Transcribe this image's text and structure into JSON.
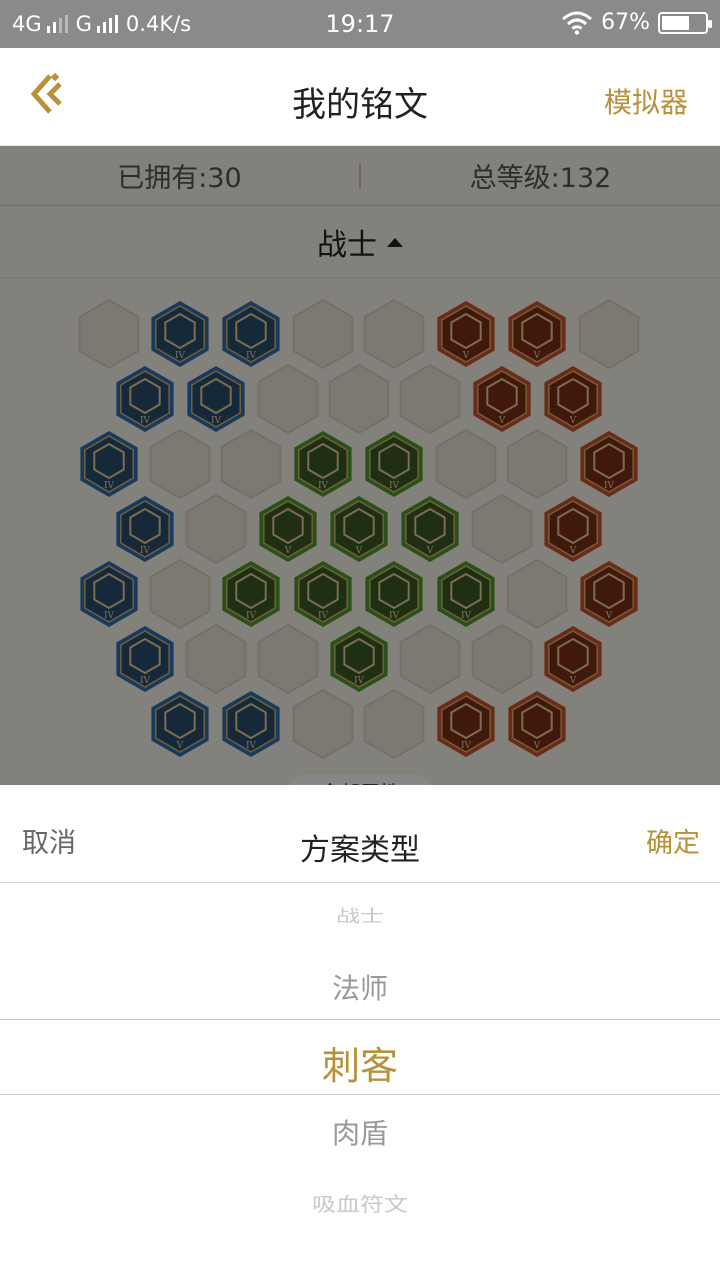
{
  "status_bar": {
    "network_1": "4G",
    "network_2": "G",
    "speed": "0.4K/s",
    "time": "19:17",
    "battery": "67%",
    "battery_level": 0.67
  },
  "header": {
    "title": "我的铭文",
    "right_action": "模拟器",
    "accent_color": "#b8913b"
  },
  "stats": {
    "owned": "已拥有:30",
    "total_level": "总等级:132"
  },
  "selector": {
    "label": "战士"
  },
  "board": {
    "filter_label": "全部属性",
    "colors": {
      "blue": "#2f6fb3",
      "green": "#4f9a2f",
      "red": "#c9512f"
    },
    "runes": [
      {
        "color": "blue",
        "tier": "IV"
      },
      {
        "color": "blue",
        "tier": "IV"
      },
      {
        "color": "blue",
        "tier": "IV"
      },
      {
        "color": "blue",
        "tier": "IV"
      },
      {
        "color": "blue",
        "tier": "IV"
      },
      {
        "color": "blue",
        "tier": "IV"
      },
      {
        "color": "blue",
        "tier": "IV"
      },
      {
        "color": "blue",
        "tier": "IV"
      },
      {
        "color": "blue",
        "tier": "V"
      },
      {
        "color": "blue",
        "tier": "IV"
      },
      {
        "color": "red",
        "tier": "V"
      },
      {
        "color": "red",
        "tier": "V"
      },
      {
        "color": "red",
        "tier": "V"
      },
      {
        "color": "red",
        "tier": "V"
      },
      {
        "color": "red",
        "tier": "IV"
      },
      {
        "color": "red",
        "tier": "V"
      },
      {
        "color": "red",
        "tier": "V"
      },
      {
        "color": "red",
        "tier": "V"
      },
      {
        "color": "red",
        "tier": "IV"
      },
      {
        "color": "red",
        "tier": "V"
      },
      {
        "color": "green",
        "tier": "IV"
      },
      {
        "color": "green",
        "tier": "IV"
      },
      {
        "color": "green",
        "tier": "V"
      },
      {
        "color": "green",
        "tier": "V"
      },
      {
        "color": "green",
        "tier": "V"
      },
      {
        "color": "green",
        "tier": "IV"
      },
      {
        "color": "green",
        "tier": "IV"
      },
      {
        "color": "green",
        "tier": "IV"
      },
      {
        "color": "green",
        "tier": "IV"
      },
      {
        "color": "green",
        "tier": "IV"
      }
    ]
  },
  "sheet": {
    "cancel": "取消",
    "title": "方案类型",
    "confirm": "确定",
    "options": [
      "战士",
      "法师",
      "刺客",
      "肉盾",
      "吸血符文"
    ],
    "selected": "刺客"
  }
}
